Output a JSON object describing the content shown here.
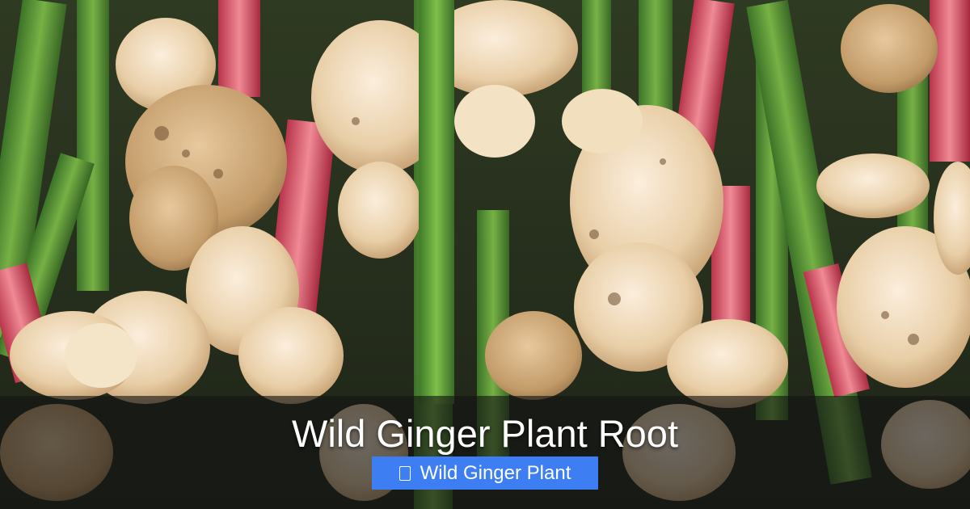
{
  "hero": {
    "title": "Wild Ginger Plant Root",
    "photo_subject": "ginger-roots-with-green-stalks"
  },
  "badge": {
    "label": "Wild Ginger Plant",
    "icon": "tag-icon",
    "color": "#3d7ef2"
  }
}
